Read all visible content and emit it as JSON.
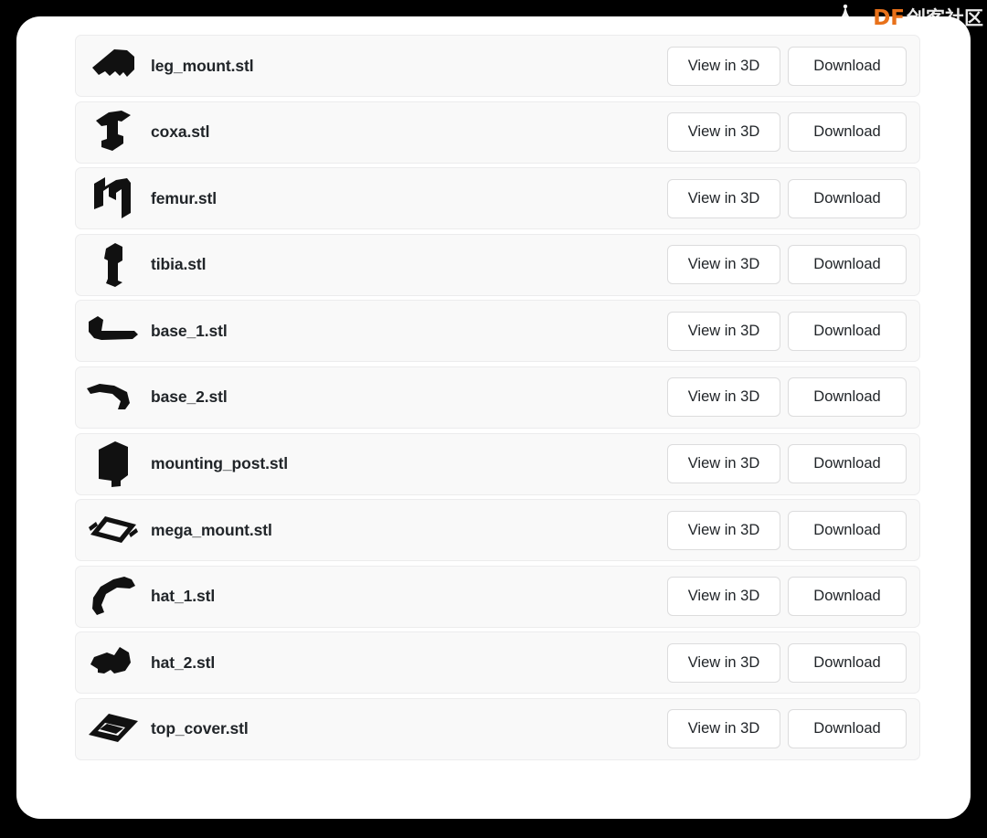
{
  "watermark": {
    "brand": "DF",
    "text": "创客社区",
    "logo_icon": "mountain-arch-logo-icon",
    "brand_color": "#e8711a",
    "text_color": "#ffffff"
  },
  "window": {
    "background": "#ffffff",
    "page_background": "#000000"
  },
  "buttons": {
    "view_label": "View in 3D",
    "download_label": "Download",
    "border_color": "#dcdcdd",
    "background": "#ffffff",
    "text_color": "#212529"
  },
  "file_list": {
    "row_background": "#f9f9f9",
    "row_border": "#ececed",
    "thumbnail_color": "#111111",
    "files": [
      {
        "name": "leg_mount.stl",
        "thumb": "stl-thumbnail-leg-mount-icon"
      },
      {
        "name": "coxa.stl",
        "thumb": "stl-thumbnail-coxa-icon"
      },
      {
        "name": "femur.stl",
        "thumb": "stl-thumbnail-femur-icon"
      },
      {
        "name": "tibia.stl",
        "thumb": "stl-thumbnail-tibia-icon"
      },
      {
        "name": "base_1.stl",
        "thumb": "stl-thumbnail-base-1-icon"
      },
      {
        "name": "base_2.stl",
        "thumb": "stl-thumbnail-base-2-icon"
      },
      {
        "name": "mounting_post.stl",
        "thumb": "stl-thumbnail-mounting-post-icon"
      },
      {
        "name": "mega_mount.stl",
        "thumb": "stl-thumbnail-mega-mount-icon"
      },
      {
        "name": "hat_1.stl",
        "thumb": "stl-thumbnail-hat-1-icon"
      },
      {
        "name": "hat_2.stl",
        "thumb": "stl-thumbnail-hat-2-icon"
      },
      {
        "name": "top_cover.stl",
        "thumb": "stl-thumbnail-top-cover-icon"
      }
    ]
  }
}
